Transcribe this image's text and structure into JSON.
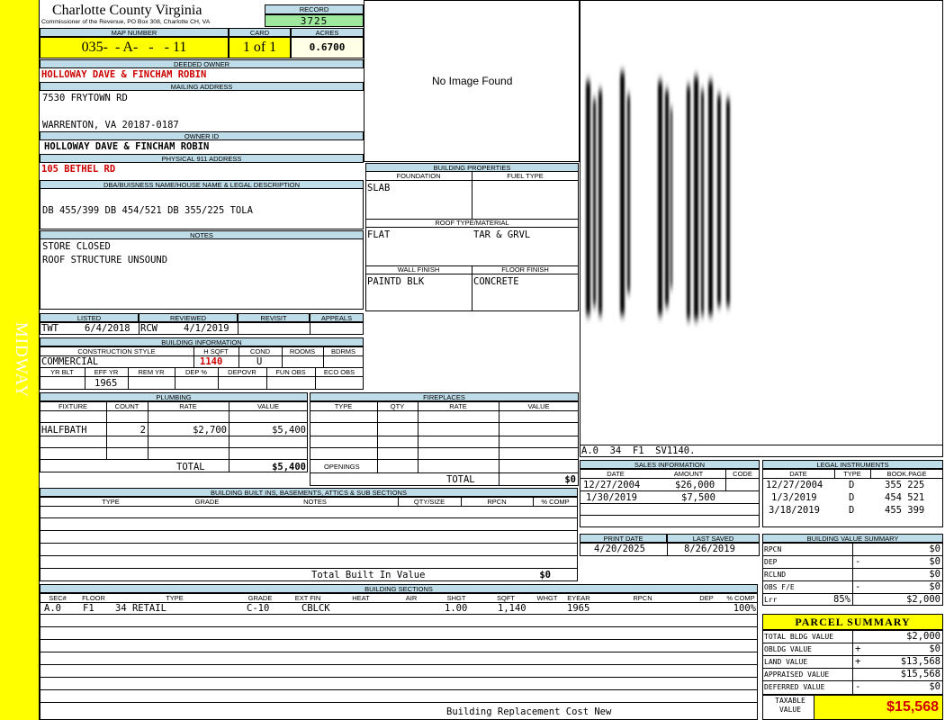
{
  "sidebar": {
    "label": "MIDWAY",
    "color": "#ffff00"
  },
  "county": {
    "title": "Charlotte County Virginia",
    "sub": "Commissioner of the Revenue, PO Box 308, Charlotte CH, VA"
  },
  "record": {
    "label": "RECORD",
    "value": "3725"
  },
  "map": {
    "label": "MAP NUMBER",
    "value": "035-  - A-   -   - 11"
  },
  "card": {
    "label": "CARD",
    "value": "1 of 1"
  },
  "acres": {
    "label": "ACRES",
    "value": "0.6700"
  },
  "owner": {
    "label": "DEEDED OWNER",
    "value": "HOLLOWAY DAVE & FINCHAM ROBIN"
  },
  "mailing": {
    "label": "MAILING ADDRESS",
    "line1": "7530 FRYTOWN RD",
    "line2": "",
    "line3": "WARRENTON, VA 20187-0187"
  },
  "owner_id": {
    "label": "OWNER ID",
    "value": "HOLLOWAY DAVE & FINCHAM ROBIN"
  },
  "physical": {
    "label": "PHYSICAL 911 ADDRESS",
    "value": "105 BETHEL RD"
  },
  "dba": {
    "label": "DBA/BUISNESS NAME/HOUSE NAME & LEGAL DESCRIPTION",
    "value": "DB 455/399 DB 454/521 DB 355/225 TOLA"
  },
  "notes": {
    "label": "NOTES",
    "line1": "STORE CLOSED",
    "line2": "ROOF STRUCTURE UNSOUND"
  },
  "image": {
    "text": "No Image Found"
  },
  "bldg_props": {
    "label": "BUILDING PROPERTIES",
    "foundation_label": "FOUNDATION",
    "fuel_label": "FUEL TYPE",
    "foundation": "SLAB",
    "fuel": "",
    "roof_label": "ROOF TYPE/MATERIAL",
    "roof_type": "FLAT",
    "roof_mat": "TAR & GRVL",
    "wall_label": "WALL FINISH",
    "floor_label": "FLOOR FINISH",
    "wall": "PAINTD BLK",
    "floor": "CONCRETE"
  },
  "listing": {
    "listed_label": "LISTED",
    "reviewed_label": "REVIEWED",
    "revisit_label": "REVISIT",
    "appeals_label": "APPEALS",
    "listed_by": "TWT",
    "listed_date": "6/4/2018",
    "reviewed_by": "RCW",
    "reviewed_date": "4/1/2019"
  },
  "bldg_info": {
    "label": "BUILDING INFORMATION",
    "cs_label": "CONSTRUCTION STYLE",
    "hsqft_label": "H SQFT",
    "cond_label": "COND",
    "rooms_label": "ROOMS",
    "bdrms_label": "BDRMS",
    "cs": "COMMERCIAL",
    "hsqft": "1140",
    "cond": "U",
    "yrblt_label": "YR BLT",
    "effyr_label": "EFF YR",
    "remyr_label": "REM YR",
    "dep_label": "DEP %",
    "depovr_label": "DEPOVR",
    "funobs_label": "FUN OBS",
    "ecoobs_label": "ECO OBS",
    "effyr": "1965"
  },
  "plumbing": {
    "label": "PLUMBING",
    "fixture_label": "FIXTURE",
    "count_label": "COUNT",
    "rate_label": "RATE",
    "value_label": "VALUE",
    "fixture": "HALFBATH",
    "count": "2",
    "rate": "$2,700",
    "value": "$5,400",
    "total_label": "TOTAL",
    "total": "$5,400"
  },
  "fireplaces": {
    "label": "FIREPLACES",
    "type_label": "TYPE",
    "qty_label": "QTY",
    "rate_label": "RATE",
    "value_label": "VALUE",
    "openings_label": "OPENINGS",
    "total_label": "TOTAL",
    "total": "$0"
  },
  "builtins": {
    "label": "BUILDING BUILT INS, BASEMENTS, ATTICS & SUB SECTIONS",
    "type": "TYPE",
    "grade": "GRADE",
    "notes": "NOTES",
    "qty": "QTY/SIZE",
    "rpcn": "RPCN",
    "pcomp": "% COMP",
    "total_label": "Total Built In Value",
    "total": "$0"
  },
  "sections": {
    "label": "BUILDING SECTIONS",
    "cols": [
      "SEC#",
      "FLOOR",
      "TYPE",
      "GRADE",
      "EXT FIN",
      "HEAT",
      "AIR",
      "SHGT",
      "SQFT",
      "WHGT",
      "EYEAR",
      "RPCN",
      "DEP",
      "% COMP"
    ],
    "row": {
      "sec": "A.0",
      "floor": "F1",
      "type": "34 RETAIL",
      "grade": "C-10",
      "extfin": "CBLCK",
      "shgt": "1.00",
      "sqft": "1,140",
      "eyear": "1965",
      "pcomp": "100%"
    },
    "footer": "Building Replacement Cost New"
  },
  "sketch": {
    "label": "A.0  34  F1  SV1140."
  },
  "sales": {
    "label": "SALES INFORMATION",
    "date_label": "DATE",
    "amount_label": "AMOUNT",
    "code_label": "CODE",
    "rows": [
      {
        "date": "12/27/2004",
        "amount": "$26,000"
      },
      {
        "date": "1/30/2019",
        "amount": "$7,500"
      }
    ]
  },
  "legal": {
    "label": "LEGAL INSTRUMENTS",
    "date_label": "DATE",
    "type_label": "TYPE",
    "bp_label": "BOOK.PAGE",
    "rows": [
      {
        "date": "12/27/2004",
        "type": "D",
        "bp": "355 225"
      },
      {
        "date": "1/3/2019",
        "type": "D",
        "bp": "454 521"
      },
      {
        "date": "3/18/2019",
        "type": "D",
        "bp": "455 399"
      }
    ]
  },
  "print": {
    "label": "PRINT DATE",
    "value": "4/20/2025"
  },
  "saved": {
    "label": "LAST SAVED",
    "value": "8/26/2019"
  },
  "bvs": {
    "label": "BUILDING VALUE SUMMARY",
    "rows": [
      {
        "k": "RPCN",
        "op": "",
        "v": "$0"
      },
      {
        "k": "DEP",
        "op": "-",
        "v": "$0"
      },
      {
        "k": "RCLND",
        "op": "",
        "v": "$0"
      },
      {
        "k": "OBS F/E",
        "op": "-",
        "v": "$0"
      },
      {
        "k": "Lrr",
        "op": "85%",
        "v": "$2,000"
      }
    ]
  },
  "parcel": {
    "label": "PARCEL SUMMARY",
    "rows": [
      {
        "k": "TOTAL BLDG VALUE",
        "op": "",
        "v": "$2,000"
      },
      {
        "k": "OBLDG VALUE",
        "op": "+",
        "v": "$0"
      },
      {
        "k": "LAND VALUE",
        "op": "+",
        "v": "$13,568"
      },
      {
        "k": "APPRAISED VALUE",
        "op": "",
        "v": "$15,568"
      },
      {
        "k": "DEFERRED VALUE",
        "op": "-",
        "v": "$0"
      }
    ],
    "taxable_label": "TAXABLE VALUE",
    "taxable": "$15,568",
    "color": "#ffff00"
  }
}
